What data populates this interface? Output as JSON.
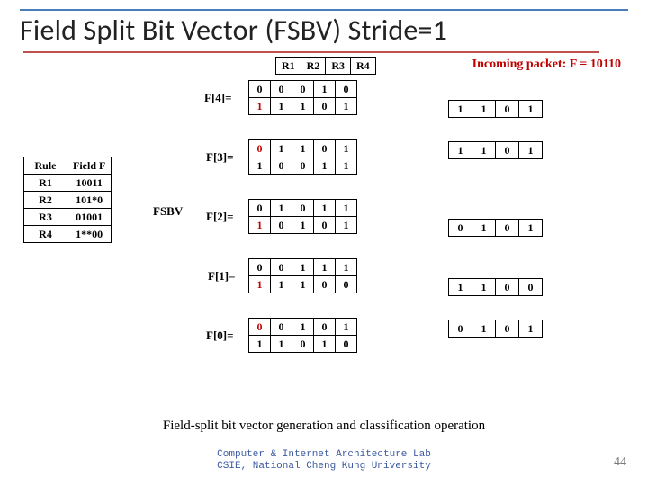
{
  "title": "Field Split Bit Vector (FSBV) Stride=1",
  "incoming": "Incoming packet: F = 10110",
  "fsbv_label": "FSBV",
  "rules": {
    "headers": [
      "Rule",
      "Field F"
    ],
    "rows": [
      [
        "R1",
        "10011"
      ],
      [
        "R2",
        "101*0"
      ],
      [
        "R3",
        "01001"
      ],
      [
        "R4",
        "1**00"
      ]
    ]
  },
  "col_headers": [
    "R1",
    "R2",
    "R3",
    "R4"
  ],
  "flabels": {
    "f4": "F[4]=",
    "f3": "F[3]=",
    "f2": "F[2]=",
    "f1": "F[1]=",
    "f0": "F[0]="
  },
  "F4": {
    "idx": [
      "0",
      "1"
    ],
    "rows": [
      [
        "0",
        "0",
        "1",
        "0"
      ],
      [
        "1",
        "1",
        "0",
        "1"
      ]
    ],
    "hi": 1
  },
  "F3": {
    "idx": [
      "0",
      "1"
    ],
    "rows": [
      [
        "1",
        "1",
        "0",
        "1"
      ],
      [
        "0",
        "0",
        "1",
        "1"
      ]
    ],
    "hi": 0
  },
  "F2": {
    "idx": [
      "0",
      "1"
    ],
    "rows": [
      [
        "1",
        "0",
        "1",
        "1"
      ],
      [
        "0",
        "1",
        "0",
        "1"
      ]
    ],
    "hi": 1
  },
  "F1": {
    "idx": [
      "0",
      "1"
    ],
    "rows": [
      [
        "0",
        "1",
        "1",
        "1"
      ],
      [
        "1",
        "1",
        "0",
        "0"
      ]
    ],
    "hi": 1
  },
  "F0": {
    "idx": [
      "0",
      "1"
    ],
    "rows": [
      [
        "0",
        "1",
        "0",
        "1"
      ],
      [
        "1",
        "0",
        "1",
        "0"
      ]
    ],
    "hi": 0
  },
  "results": {
    "r4": [
      "1",
      "1",
      "0",
      "1"
    ],
    "r3": [
      "1",
      "1",
      "0",
      "1"
    ],
    "r2": [
      "0",
      "1",
      "0",
      "1"
    ],
    "r1": [
      "1",
      "1",
      "0",
      "0"
    ],
    "r0": [
      "0",
      "1",
      "0",
      "1"
    ]
  },
  "caption": "Field-split bit vector generation and classification operation",
  "footer": {
    "l1": "Computer & Internet Architecture Lab",
    "l2": "CSIE, National Cheng Kung University"
  },
  "page": "44"
}
